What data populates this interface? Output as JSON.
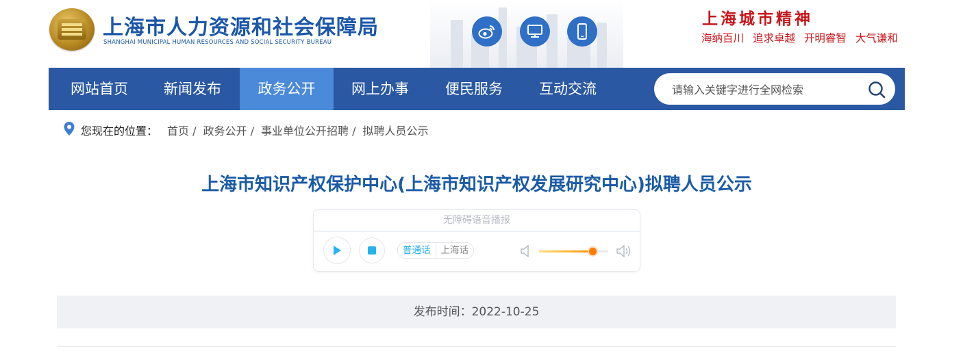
{
  "header": {
    "org_name": "上海市人力资源和社会保障局",
    "org_name_en": "SHANGHAI MUNICIPAL HUMAN RESOURCES AND SOCIAL SECURITY BUREAU",
    "icons": [
      "weibo-icon",
      "desktop-icon",
      "mobile-icon"
    ],
    "slogan_title": "上海城市精神",
    "slogans": [
      "海纳百川",
      "追求卓越",
      "开明睿智",
      "大气谦和"
    ]
  },
  "nav": {
    "items": [
      "网站首页",
      "新闻发布",
      "政务公开",
      "网上办事",
      "便民服务",
      "互动交流"
    ],
    "active_index": 2
  },
  "search": {
    "placeholder": "请输入关键字进行全网检索"
  },
  "breadcrumb": {
    "label": "您现在的位置：",
    "items": [
      "首页 /",
      "政务公开 /",
      "事业单位公开招聘 /",
      "拟聘人员公示"
    ]
  },
  "article": {
    "title": "上海市知识产权保护中心(上海市知识产权发展研究中心)拟聘人员公示",
    "publish": "发布时间：2022-10-25"
  },
  "player": {
    "header": "无障碍语音播报",
    "lang_options": [
      "普通话",
      "上海话"
    ],
    "selected_lang": "普通话",
    "volume": 0.78
  },
  "colors": {
    "nav_bg": "#2a58a2",
    "nav_active": "#4a8ad8",
    "brand_blue": "#1b57a8",
    "slogan_red": "#c8151b",
    "player_accent": "#1eaae6"
  }
}
